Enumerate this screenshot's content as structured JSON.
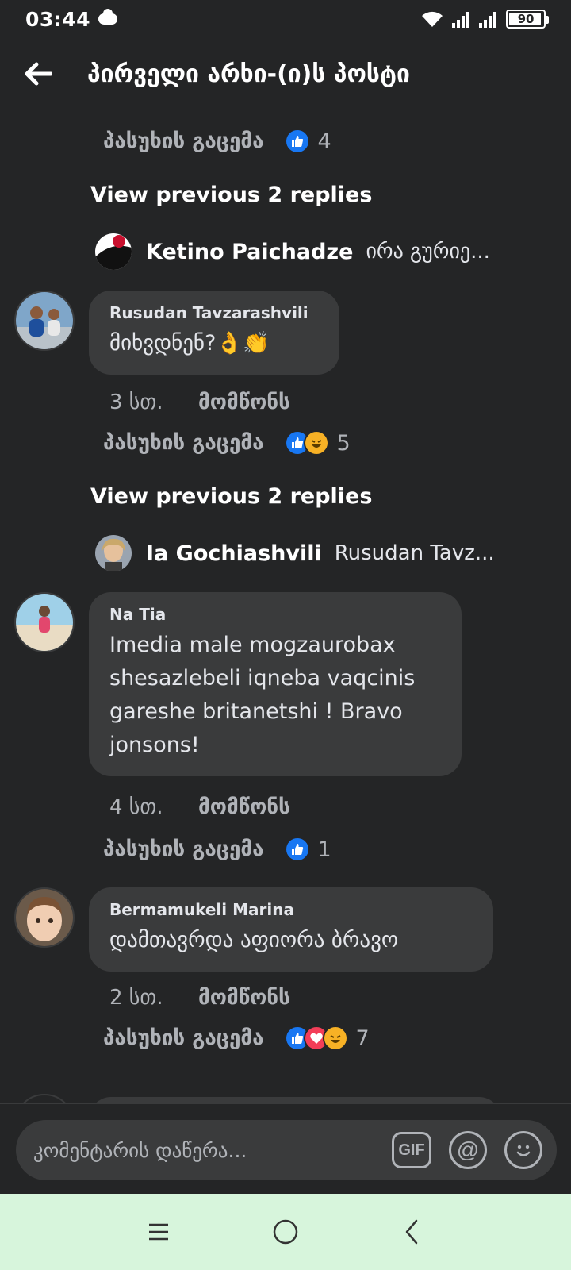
{
  "status_bar": {
    "time": "03:44",
    "battery": "90"
  },
  "header": {
    "title": "პირველი არხი-(ი)ს პოსტი"
  },
  "thread_top": {
    "reply_label": "პასუხის გაცემა",
    "reaction_count": "4",
    "view_previous": "View previous 2 replies",
    "preview_name": "Ketino Paichadze",
    "preview_text": "ირა გურიე..."
  },
  "comments": [
    {
      "author": "Rusudan Tavzarashvili",
      "text": "მიხვდნენ?👌👏",
      "time": "3 სთ.",
      "like_label": "მომწონს",
      "reply_label": "პასუხის გაცემა",
      "reactions": [
        "like",
        "haha"
      ],
      "reaction_count": "5",
      "view_previous": "View previous 2 replies",
      "preview_name": "Ia Gochiashvili",
      "preview_text": "Rusudan Tavz..."
    },
    {
      "author": "Na Tia",
      "text_lines": [
        "Imedia male mogzaurobax",
        "shesazlebeli iqneba vaqcinis",
        "gareshe britanetshi ! Bravo",
        "jonsons!"
      ],
      "time": "4 სთ.",
      "like_label": "მომწონს",
      "reply_label": "პასუხის გაცემა",
      "reactions": [
        "like"
      ],
      "reaction_count": "1"
    },
    {
      "author": "Bermamukeli Marina",
      "text": "დამთავრდა აფიორა ბრავო",
      "time": "2 სთ.",
      "like_label": "მომწონს",
      "reply_label": "პასუხის გაცემა",
      "reactions": [
        "like",
        "love",
        "haha"
      ],
      "reaction_count": "7"
    }
  ],
  "composer": {
    "placeholder": "კომენტარის დაწერა...",
    "gif_label": "GIF",
    "mention_label": "@"
  },
  "icons": {
    "back": "arrow-left-icon",
    "recents": "recent-apps-icon",
    "home": "home-circle-icon",
    "nav_back": "chevron-left-icon"
  },
  "colors": {
    "background": "#242526",
    "bubble": "#3a3b3c",
    "like_blue": "#1877f2",
    "love_red": "#f33e58",
    "haha_yellow": "#f7b125",
    "navbar": "#d7f5dc"
  }
}
